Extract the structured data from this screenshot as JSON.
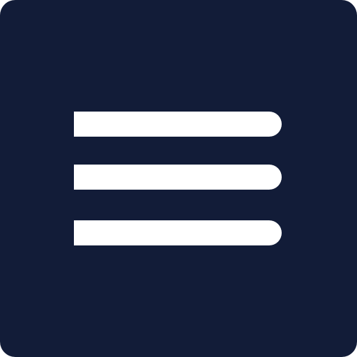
{
  "icon": {
    "name": "menu-icon",
    "background_color": "#121c38",
    "line_color": "#ffffff",
    "line_count": 3
  }
}
